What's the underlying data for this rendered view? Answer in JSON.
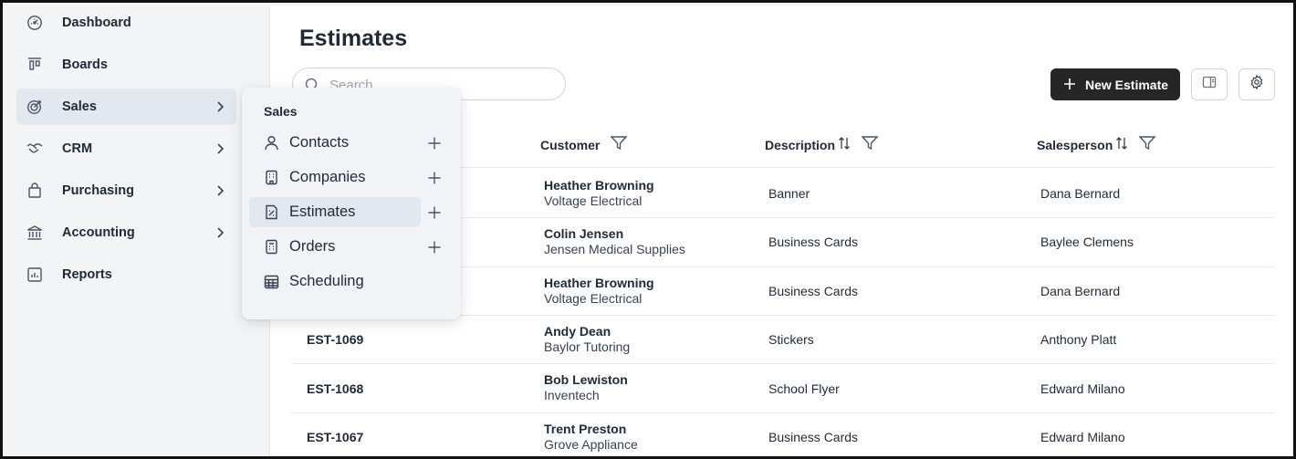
{
  "sidebar": {
    "items": [
      {
        "label": "Dashboard",
        "icon": "dashboard-gauge-icon"
      },
      {
        "label": "Boards",
        "icon": "boards-icon"
      },
      {
        "label": "Sales",
        "icon": "target-icon",
        "active": true,
        "has_submenu": true
      },
      {
        "label": "CRM",
        "icon": "handshake-icon",
        "has_submenu": true
      },
      {
        "label": "Purchasing",
        "icon": "shopping-bag-icon",
        "has_submenu": true
      },
      {
        "label": "Accounting",
        "icon": "bank-icon",
        "has_submenu": true
      },
      {
        "label": "Reports",
        "icon": "bar-chart-icon"
      }
    ]
  },
  "flyout": {
    "title": "Sales",
    "items": [
      {
        "label": "Contacts",
        "icon": "person-icon",
        "add": true
      },
      {
        "label": "Companies",
        "icon": "building-icon",
        "add": true
      },
      {
        "label": "Estimates",
        "icon": "estimate-document-icon",
        "add": true,
        "active": true
      },
      {
        "label": "Orders",
        "icon": "orders-document-icon",
        "add": true
      },
      {
        "label": "Scheduling",
        "icon": "calendar-icon",
        "add": false
      }
    ]
  },
  "main": {
    "title": "Estimates",
    "search": {
      "placeholder": "Search",
      "value": ""
    },
    "new_button_label": "New Estimate",
    "columns": {
      "customer": "Customer",
      "description": "Description",
      "salesperson": "Salesperson"
    },
    "rows": [
      {
        "id": "",
        "customer": "Heather Browning",
        "company": "Voltage Electrical",
        "description": "Banner",
        "salesperson": "Dana Bernard"
      },
      {
        "id": "",
        "customer": "Colin Jensen",
        "company": "Jensen Medical Supplies",
        "description": "Business Cards",
        "salesperson": "Baylee Clemens"
      },
      {
        "id": "",
        "customer": "Heather Browning",
        "company": "Voltage Electrical",
        "description": "Business Cards",
        "salesperson": "Dana Bernard"
      },
      {
        "id": "EST-1069",
        "customer": "Andy Dean",
        "company": "Baylor Tutoring",
        "description": "Stickers",
        "salesperson": "Anthony Platt"
      },
      {
        "id": "EST-1068",
        "customer": "Bob Lewiston",
        "company": "Inventech",
        "description": "School Flyer",
        "salesperson": "Edward Milano"
      },
      {
        "id": "EST-1067",
        "customer": "Trent Preston",
        "company": "Grove Appliance",
        "description": "Business Cards",
        "salesperson": "Edward Milano"
      }
    ]
  },
  "colors": {
    "primary_button": "#262626",
    "active_bg": "#e2e8f0",
    "sidebar_bg": "#f3f4f6",
    "flyout_bg": "#f1f3f6"
  }
}
